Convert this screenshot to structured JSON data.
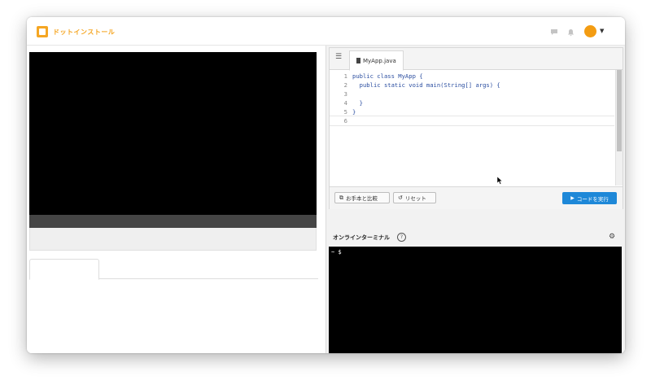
{
  "header": {
    "logo_text": "ドットインストール",
    "chat_icon": "chat-icon",
    "bell_icon": "bell-icon",
    "avatar_color": "#f39c12"
  },
  "editor": {
    "file_tab": "MyApp.java",
    "lines": [
      {
        "num": "1",
        "text": "public class MyApp {"
      },
      {
        "num": "2",
        "text": "  public static void main(String[] args) {"
      },
      {
        "num": "3",
        "text": ""
      },
      {
        "num": "4",
        "text": "  }"
      },
      {
        "num": "5",
        "text": "}"
      },
      {
        "num": "6",
        "text": ""
      }
    ],
    "compare_label": "お手本と比較",
    "reset_label": "リセット",
    "run_label": "コードを実行"
  },
  "terminal": {
    "title": "オンラインターミナル",
    "help": "?",
    "prompt": "~ $"
  },
  "colors": {
    "brand": "#f5a623",
    "run_button": "#1e88d8",
    "keyword": "#2b4ea0"
  }
}
